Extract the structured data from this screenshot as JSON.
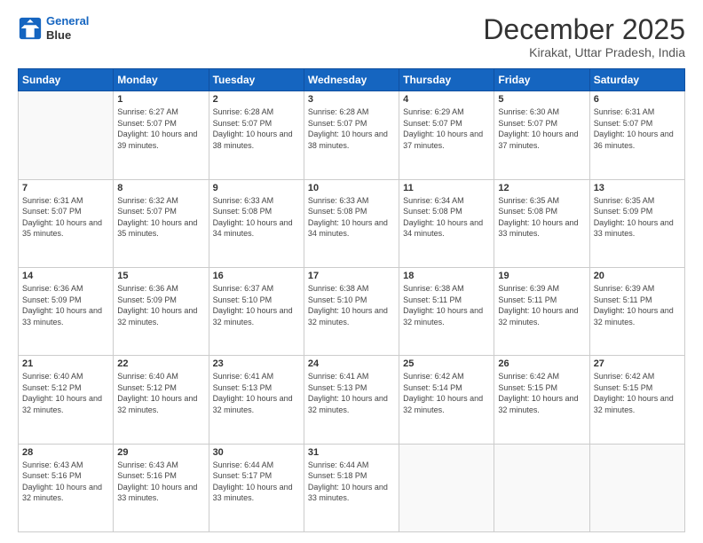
{
  "logo": {
    "line1": "General",
    "line2": "Blue"
  },
  "title": "December 2025",
  "location": "Kirakat, Uttar Pradesh, India",
  "days_of_week": [
    "Sunday",
    "Monday",
    "Tuesday",
    "Wednesday",
    "Thursday",
    "Friday",
    "Saturday"
  ],
  "weeks": [
    [
      {
        "day": "",
        "sunrise": "",
        "sunset": "",
        "daylight": ""
      },
      {
        "day": "1",
        "sunrise": "Sunrise: 6:27 AM",
        "sunset": "Sunset: 5:07 PM",
        "daylight": "Daylight: 10 hours and 39 minutes."
      },
      {
        "day": "2",
        "sunrise": "Sunrise: 6:28 AM",
        "sunset": "Sunset: 5:07 PM",
        "daylight": "Daylight: 10 hours and 38 minutes."
      },
      {
        "day": "3",
        "sunrise": "Sunrise: 6:28 AM",
        "sunset": "Sunset: 5:07 PM",
        "daylight": "Daylight: 10 hours and 38 minutes."
      },
      {
        "day": "4",
        "sunrise": "Sunrise: 6:29 AM",
        "sunset": "Sunset: 5:07 PM",
        "daylight": "Daylight: 10 hours and 37 minutes."
      },
      {
        "day": "5",
        "sunrise": "Sunrise: 6:30 AM",
        "sunset": "Sunset: 5:07 PM",
        "daylight": "Daylight: 10 hours and 37 minutes."
      },
      {
        "day": "6",
        "sunrise": "Sunrise: 6:31 AM",
        "sunset": "Sunset: 5:07 PM",
        "daylight": "Daylight: 10 hours and 36 minutes."
      }
    ],
    [
      {
        "day": "7",
        "sunrise": "Sunrise: 6:31 AM",
        "sunset": "Sunset: 5:07 PM",
        "daylight": "Daylight: 10 hours and 35 minutes."
      },
      {
        "day": "8",
        "sunrise": "Sunrise: 6:32 AM",
        "sunset": "Sunset: 5:07 PM",
        "daylight": "Daylight: 10 hours and 35 minutes."
      },
      {
        "day": "9",
        "sunrise": "Sunrise: 6:33 AM",
        "sunset": "Sunset: 5:08 PM",
        "daylight": "Daylight: 10 hours and 34 minutes."
      },
      {
        "day": "10",
        "sunrise": "Sunrise: 6:33 AM",
        "sunset": "Sunset: 5:08 PM",
        "daylight": "Daylight: 10 hours and 34 minutes."
      },
      {
        "day": "11",
        "sunrise": "Sunrise: 6:34 AM",
        "sunset": "Sunset: 5:08 PM",
        "daylight": "Daylight: 10 hours and 34 minutes."
      },
      {
        "day": "12",
        "sunrise": "Sunrise: 6:35 AM",
        "sunset": "Sunset: 5:08 PM",
        "daylight": "Daylight: 10 hours and 33 minutes."
      },
      {
        "day": "13",
        "sunrise": "Sunrise: 6:35 AM",
        "sunset": "Sunset: 5:09 PM",
        "daylight": "Daylight: 10 hours and 33 minutes."
      }
    ],
    [
      {
        "day": "14",
        "sunrise": "Sunrise: 6:36 AM",
        "sunset": "Sunset: 5:09 PM",
        "daylight": "Daylight: 10 hours and 33 minutes."
      },
      {
        "day": "15",
        "sunrise": "Sunrise: 6:36 AM",
        "sunset": "Sunset: 5:09 PM",
        "daylight": "Daylight: 10 hours and 32 minutes."
      },
      {
        "day": "16",
        "sunrise": "Sunrise: 6:37 AM",
        "sunset": "Sunset: 5:10 PM",
        "daylight": "Daylight: 10 hours and 32 minutes."
      },
      {
        "day": "17",
        "sunrise": "Sunrise: 6:38 AM",
        "sunset": "Sunset: 5:10 PM",
        "daylight": "Daylight: 10 hours and 32 minutes."
      },
      {
        "day": "18",
        "sunrise": "Sunrise: 6:38 AM",
        "sunset": "Sunset: 5:11 PM",
        "daylight": "Daylight: 10 hours and 32 minutes."
      },
      {
        "day": "19",
        "sunrise": "Sunrise: 6:39 AM",
        "sunset": "Sunset: 5:11 PM",
        "daylight": "Daylight: 10 hours and 32 minutes."
      },
      {
        "day": "20",
        "sunrise": "Sunrise: 6:39 AM",
        "sunset": "Sunset: 5:11 PM",
        "daylight": "Daylight: 10 hours and 32 minutes."
      }
    ],
    [
      {
        "day": "21",
        "sunrise": "Sunrise: 6:40 AM",
        "sunset": "Sunset: 5:12 PM",
        "daylight": "Daylight: 10 hours and 32 minutes."
      },
      {
        "day": "22",
        "sunrise": "Sunrise: 6:40 AM",
        "sunset": "Sunset: 5:12 PM",
        "daylight": "Daylight: 10 hours and 32 minutes."
      },
      {
        "day": "23",
        "sunrise": "Sunrise: 6:41 AM",
        "sunset": "Sunset: 5:13 PM",
        "daylight": "Daylight: 10 hours and 32 minutes."
      },
      {
        "day": "24",
        "sunrise": "Sunrise: 6:41 AM",
        "sunset": "Sunset: 5:13 PM",
        "daylight": "Daylight: 10 hours and 32 minutes."
      },
      {
        "day": "25",
        "sunrise": "Sunrise: 6:42 AM",
        "sunset": "Sunset: 5:14 PM",
        "daylight": "Daylight: 10 hours and 32 minutes."
      },
      {
        "day": "26",
        "sunrise": "Sunrise: 6:42 AM",
        "sunset": "Sunset: 5:15 PM",
        "daylight": "Daylight: 10 hours and 32 minutes."
      },
      {
        "day": "27",
        "sunrise": "Sunrise: 6:42 AM",
        "sunset": "Sunset: 5:15 PM",
        "daylight": "Daylight: 10 hours and 32 minutes."
      }
    ],
    [
      {
        "day": "28",
        "sunrise": "Sunrise: 6:43 AM",
        "sunset": "Sunset: 5:16 PM",
        "daylight": "Daylight: 10 hours and 32 minutes."
      },
      {
        "day": "29",
        "sunrise": "Sunrise: 6:43 AM",
        "sunset": "Sunset: 5:16 PM",
        "daylight": "Daylight: 10 hours and 33 minutes."
      },
      {
        "day": "30",
        "sunrise": "Sunrise: 6:44 AM",
        "sunset": "Sunset: 5:17 PM",
        "daylight": "Daylight: 10 hours and 33 minutes."
      },
      {
        "day": "31",
        "sunrise": "Sunrise: 6:44 AM",
        "sunset": "Sunset: 5:18 PM",
        "daylight": "Daylight: 10 hours and 33 minutes."
      },
      {
        "day": "",
        "sunrise": "",
        "sunset": "",
        "daylight": ""
      },
      {
        "day": "",
        "sunrise": "",
        "sunset": "",
        "daylight": ""
      },
      {
        "day": "",
        "sunrise": "",
        "sunset": "",
        "daylight": ""
      }
    ]
  ]
}
